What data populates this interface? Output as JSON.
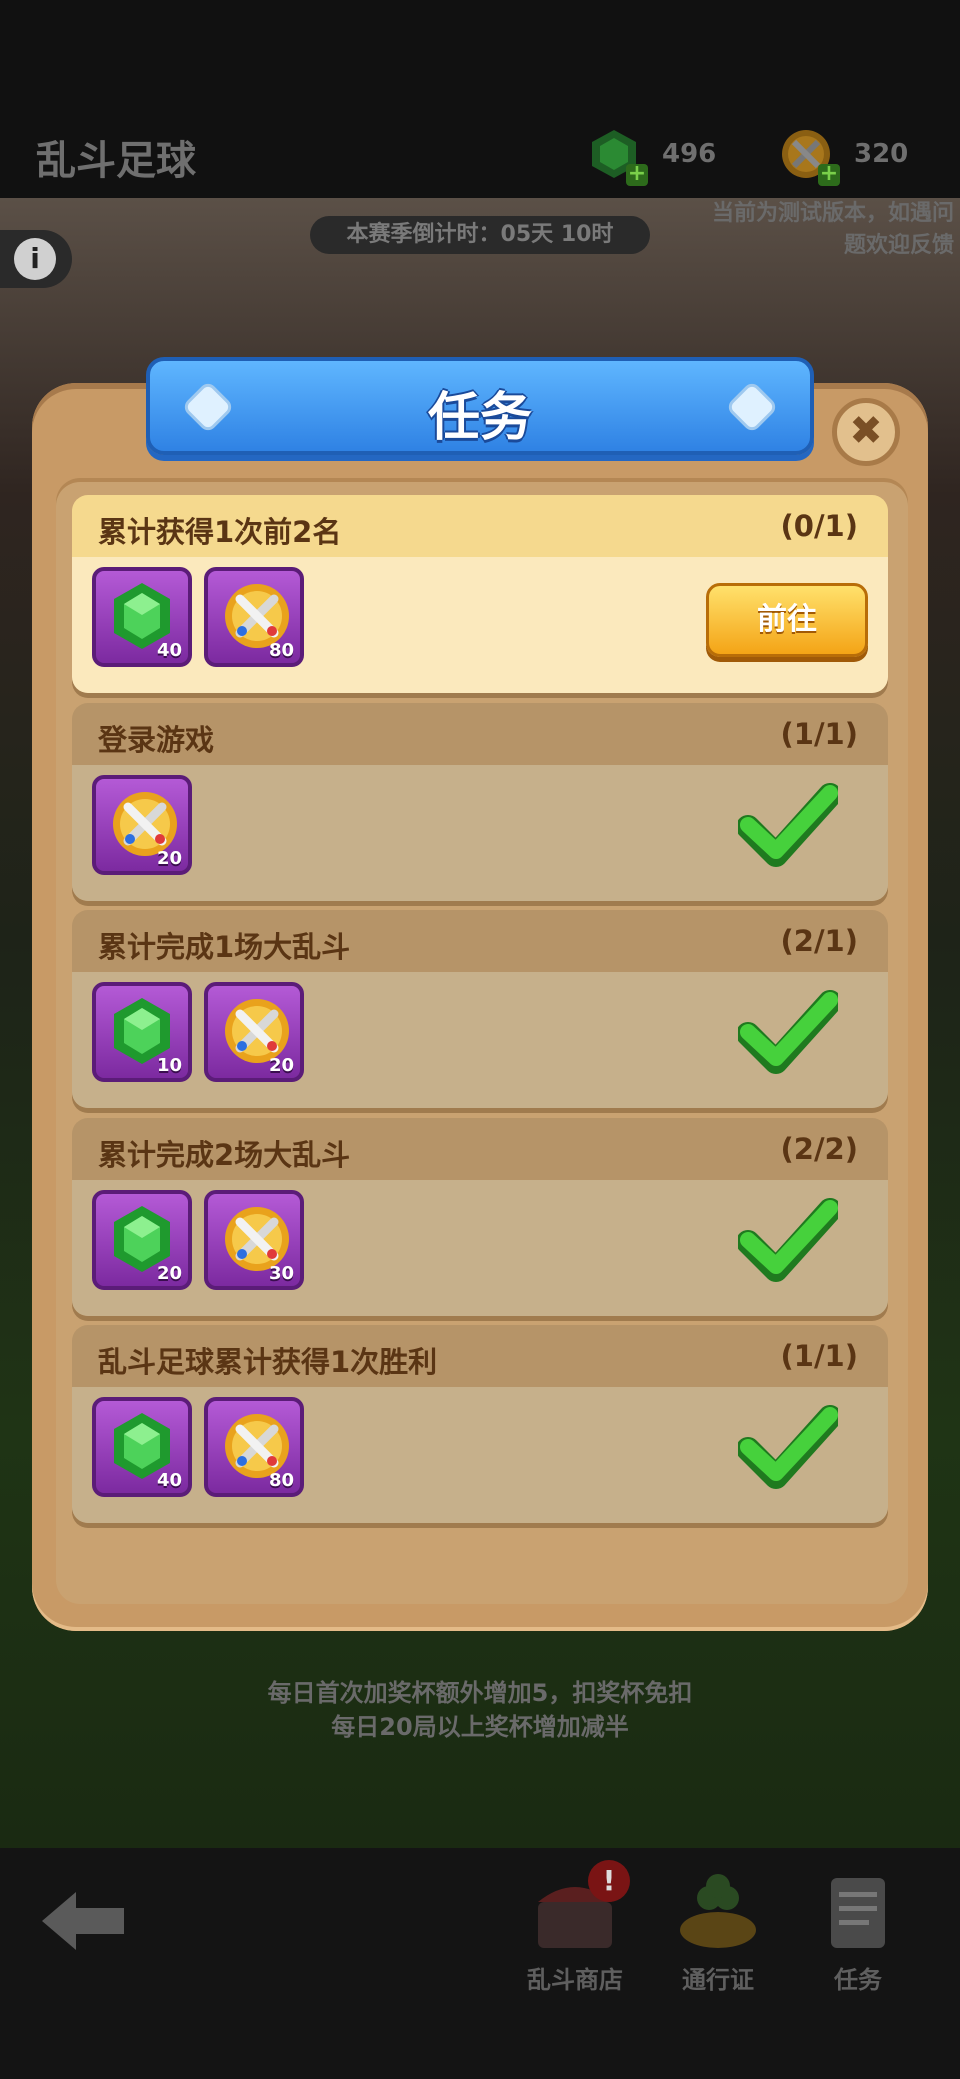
{
  "topbar": {
    "title": "乱斗足球",
    "gems": "496",
    "trophies": "320"
  },
  "scene": {
    "countdown": "本赛季倒计时：05天 10时",
    "test_note": "当前为测试版本，如遇问题欢迎反馈",
    "bonus_line1": "每日首次加奖杯额外增加5，扣奖杯免扣",
    "bonus_line2": "每日20局以上奖杯增加减半"
  },
  "modal": {
    "title": "任务",
    "close_symbol": "✖",
    "go_label": "前往"
  },
  "tasks": [
    {
      "name": "累计获得1次前2名",
      "progress": "(0/1)",
      "status": "active",
      "rewards": [
        {
          "type": "gem",
          "amount": "40"
        },
        {
          "type": "trophy",
          "amount": "80"
        }
      ]
    },
    {
      "name": "登录游戏",
      "progress": "(1/1)",
      "status": "done",
      "rewards": [
        {
          "type": "trophy",
          "amount": "20"
        }
      ]
    },
    {
      "name": "累计完成1场大乱斗",
      "progress": "(2/1)",
      "status": "done",
      "rewards": [
        {
          "type": "gem",
          "amount": "10"
        },
        {
          "type": "trophy",
          "amount": "20"
        }
      ]
    },
    {
      "name": "累计完成2场大乱斗",
      "progress": "(2/2)",
      "status": "done",
      "rewards": [
        {
          "type": "gem",
          "amount": "20"
        },
        {
          "type": "trophy",
          "amount": "30"
        }
      ]
    },
    {
      "name": "乱斗足球累计获得1次胜利",
      "progress": "(1/1)",
      "status": "done",
      "rewards": [
        {
          "type": "gem",
          "amount": "40"
        },
        {
          "type": "trophy",
          "amount": "80"
        }
      ]
    }
  ],
  "bottom_nav": {
    "shop": "乱斗商店",
    "pass": "通行证",
    "tasks": "任务",
    "shop_badge": "!"
  },
  "colors": {
    "modal_bg": "#c89a66",
    "header_blue": "#2f82e4",
    "check_green": "#3ec13a",
    "reward_purple": "#9b3fc0"
  }
}
